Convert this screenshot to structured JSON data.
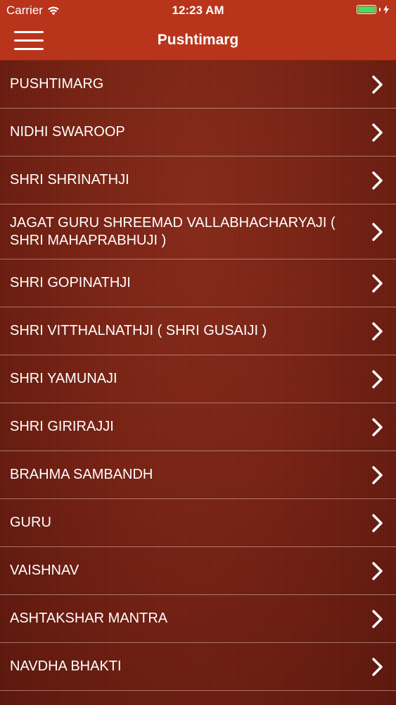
{
  "status_bar": {
    "carrier": "Carrier",
    "time": "12:23 AM",
    "battery_color": "#4cd964",
    "battery_level": 1.0
  },
  "nav_bar": {
    "title": "Pushtimarg",
    "background_color": "#b8341b",
    "menu_icon": "hamburger-menu-icon"
  },
  "list": {
    "items": [
      {
        "label": "PUSHTIMARG"
      },
      {
        "label": "NIDHI SWAROOP"
      },
      {
        "label": "SHRI SHRINATHJI"
      },
      {
        "label": "JAGAT GURU SHREEMAD VALLABHACHARYAJI ( SHRI MAHAPRABHUJI )"
      },
      {
        "label": "SHRI GOPINATHJI"
      },
      {
        "label": "SHRI VITTHALNATHJI ( SHRI GUSAIJI )"
      },
      {
        "label": "SHRI YAMUNAJI"
      },
      {
        "label": "SHRI GIRIRAJJI"
      },
      {
        "label": "BRAHMA SAMBANDH"
      },
      {
        "label": "GURU"
      },
      {
        "label": "VAISHNAV"
      },
      {
        "label": "ASHTAKSHAR MANTRA"
      },
      {
        "label": "NAVDHA BHAKTI"
      }
    ],
    "chevron_icon": "chevron-right-icon"
  }
}
